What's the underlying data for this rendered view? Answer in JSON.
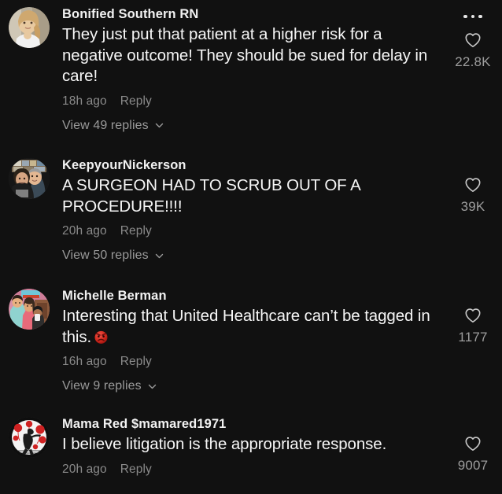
{
  "app": {
    "background_color": "#111111",
    "text_color": "#f6f6f6",
    "muted_color": "#8a8a8a"
  },
  "comments": [
    {
      "username": "Bonified Southern RN",
      "text": "They just put that patient at a higher risk for a negative outcome! They should be sued for delay in care!",
      "timestamp": "18h ago",
      "reply_label": "Reply",
      "view_replies_label": "View 49 replies",
      "reply_count": 49,
      "like_count": "22.8K",
      "has_more_menu": true,
      "avatar_alt": "blonde-woman-photo"
    },
    {
      "username": "KeepyourNickerson",
      "text": "A SURGEON HAD TO SCRUB OUT OF A PROCEDURE!!!!",
      "timestamp": "20h ago",
      "reply_label": "Reply",
      "view_replies_label": "View 50 replies",
      "reply_count": 50,
      "like_count": "39K",
      "has_more_menu": false,
      "avatar_alt": "couple-photo"
    },
    {
      "username": "Michelle Berman",
      "text": "Interesting that United Healthcare can’t be tagged in this.",
      "emoji": "angry-face",
      "timestamp": "16h ago",
      "reply_label": "Reply",
      "view_replies_label": "View 9 replies",
      "reply_count": 9,
      "like_count": "1177",
      "has_more_menu": false,
      "avatar_alt": "illustrated-people-photo"
    },
    {
      "username": "Mama Red $mamared1971",
      "text": "I believe litigation is the appropriate response.",
      "timestamp": "20h ago",
      "reply_label": "Reply",
      "view_replies_label": "",
      "like_count": "9007",
      "has_more_menu": false,
      "avatar_alt": "red-flowers-illustration"
    }
  ],
  "icons": {
    "heart": "heart-outline-icon",
    "more": "more-options-icon",
    "chevron": "chevron-down-icon"
  }
}
